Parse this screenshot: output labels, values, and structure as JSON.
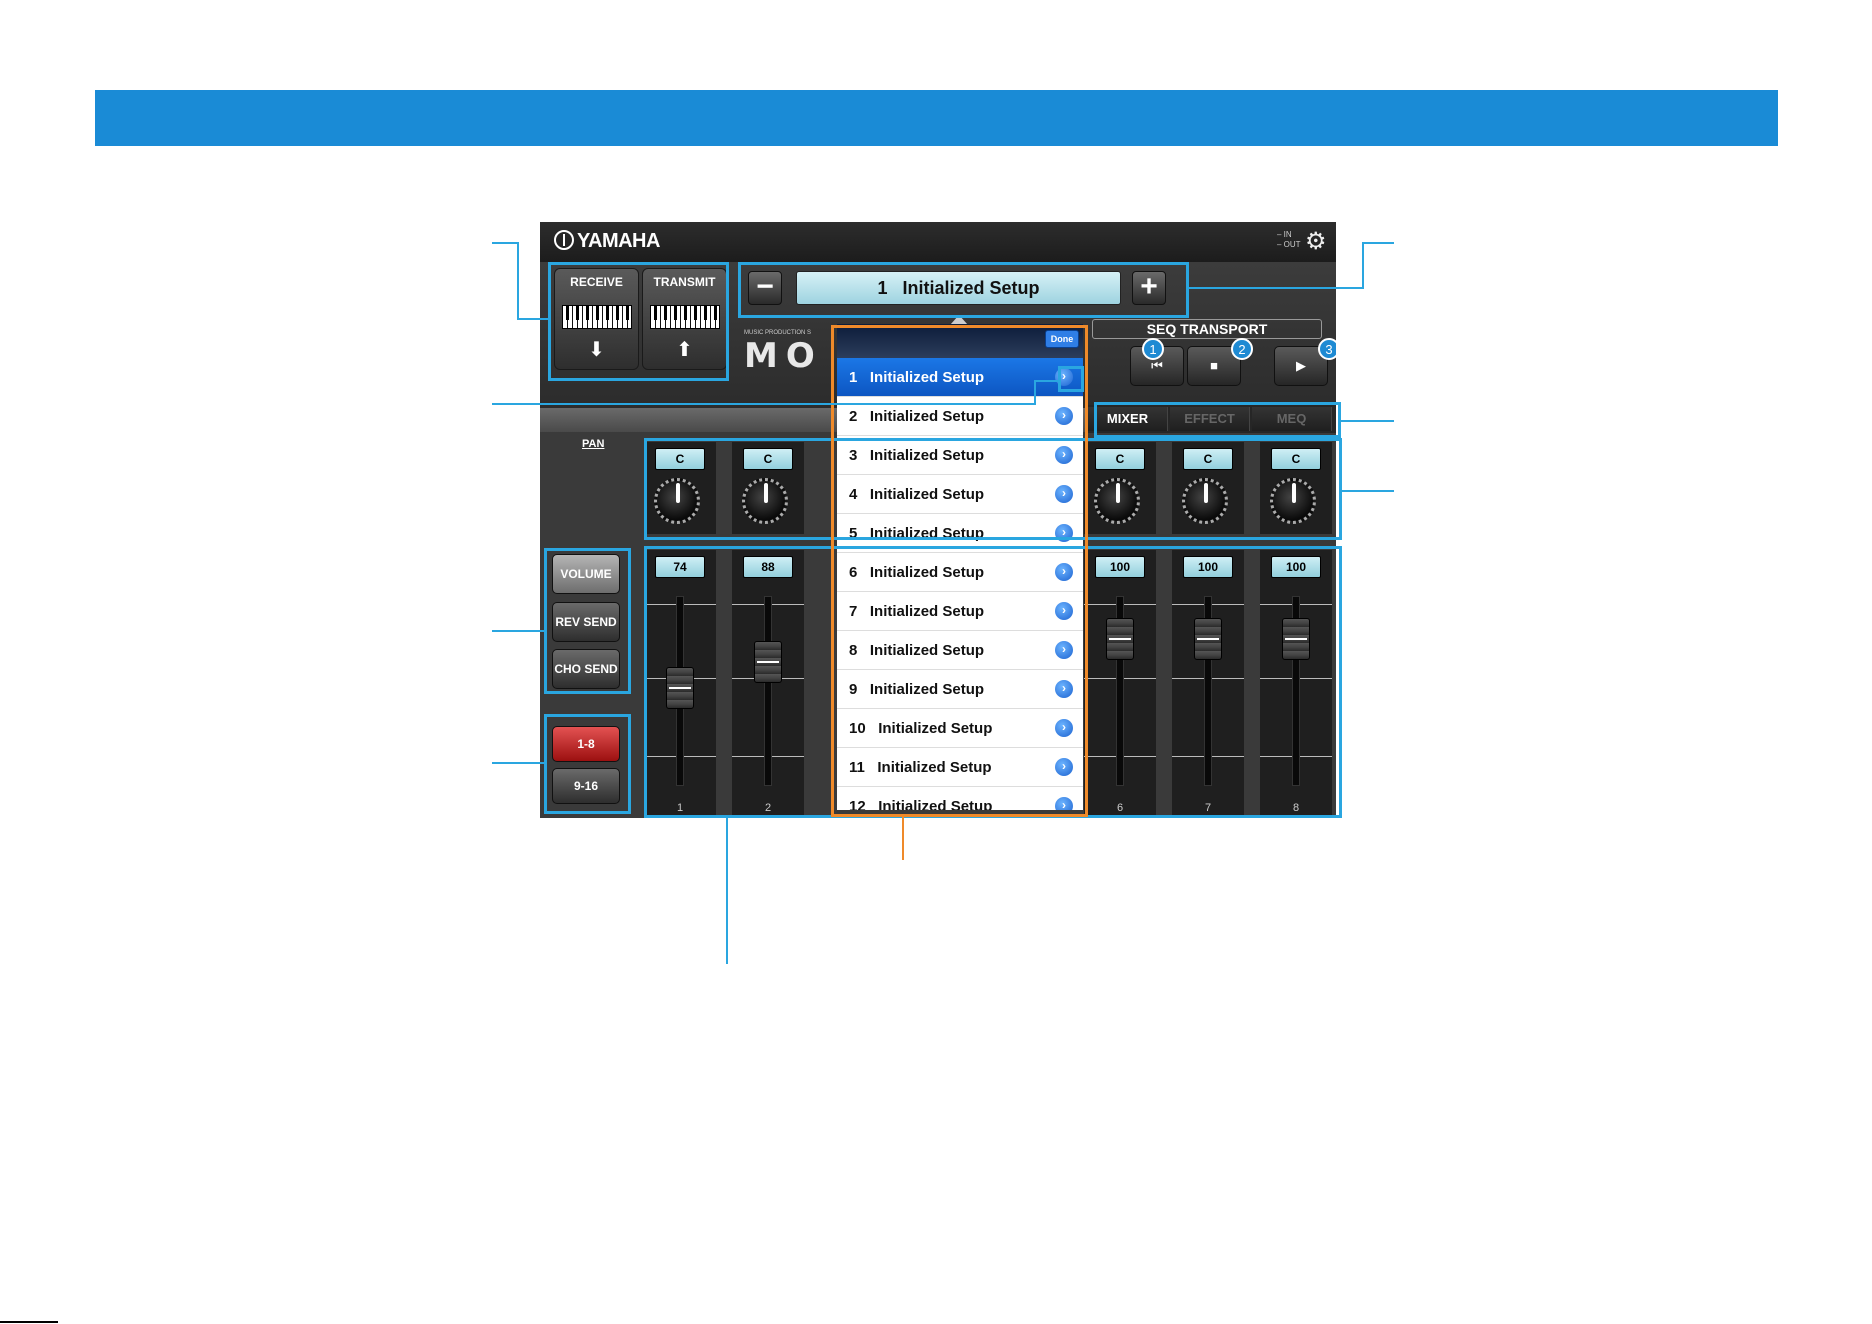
{
  "header_band_color": "#1a8bd6",
  "app": {
    "brand": "YAMAHA",
    "io": {
      "in": "IN",
      "out": "OUT"
    },
    "receive_label": "RECEIVE",
    "transmit_label": "TRANSMIT",
    "setup": {
      "number": "1",
      "name": "Initialized Setup",
      "minus": "−",
      "plus": "+"
    },
    "brand_small": "MUSIC PRODUCTION S",
    "brand_model": "MO",
    "seq": {
      "title": "SEQ TRANSPORT",
      "buttons": [
        {
          "symbol": "⏮",
          "badge": "1"
        },
        {
          "symbol": "■",
          "badge": "2"
        },
        {
          "symbol": "▶",
          "badge": "3"
        }
      ]
    },
    "tabs": [
      "MIXER",
      "EFFECT",
      "MEQ"
    ],
    "pan_label": "PAN",
    "side_buttons": {
      "volume": "VOLUME",
      "rev_send": "REV SEND",
      "cho_send": "CHO SEND"
    },
    "part_buttons": {
      "lower": "1-8",
      "upper": "9-16"
    },
    "channels": [
      {
        "num": "1",
        "pan": "C",
        "value": "74",
        "level": 0.74
      },
      {
        "num": "2",
        "pan": "C",
        "value": "88",
        "level": 0.88
      },
      {
        "num": "6",
        "pan": "C",
        "value": "100",
        "level": 1.0
      },
      {
        "num": "7",
        "pan": "C",
        "value": "100",
        "level": 1.0
      },
      {
        "num": "8",
        "pan": "C",
        "value": "100",
        "level": 1.0
      }
    ]
  },
  "popover": {
    "done_label": "Done",
    "items": [
      {
        "num": "1",
        "name": "Initialized Setup"
      },
      {
        "num": "2",
        "name": "Initialized Setup"
      },
      {
        "num": "3",
        "name": "Initialized Setup"
      },
      {
        "num": "4",
        "name": "Initialized Setup"
      },
      {
        "num": "5",
        "name": "Initialized Setup"
      },
      {
        "num": "6",
        "name": "Initialized Setup"
      },
      {
        "num": "7",
        "name": "Initialized Setup"
      },
      {
        "num": "8",
        "name": "Initialized Setup"
      },
      {
        "num": "9",
        "name": "Initialized Setup"
      },
      {
        "num": "10",
        "name": "Initialized Setup"
      },
      {
        "num": "11",
        "name": "Initialized Setup"
      },
      {
        "num": "12",
        "name": "Initialized Setup"
      }
    ]
  }
}
